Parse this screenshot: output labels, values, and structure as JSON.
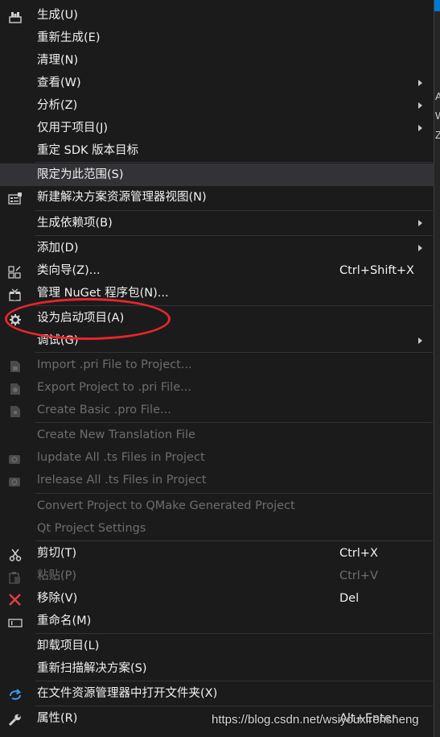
{
  "menu": {
    "items": [
      {
        "label": "生成(U)",
        "icon": "build-icon"
      },
      {
        "label": "重新生成(E)"
      },
      {
        "label": "清理(N)"
      },
      {
        "label": "查看(W)",
        "submenu": true
      },
      {
        "label": "分析(Z)",
        "submenu": true
      },
      {
        "label": "仅用于项目(J)",
        "submenu": true
      },
      {
        "label": "重定 SDK 版本目标"
      },
      {
        "label": "限定为此范围(S)",
        "highlighted": true
      },
      {
        "label": "新建解决方案资源管理器视图(N)",
        "icon": "new-solution-view-icon"
      },
      {
        "label": "生成依赖项(B)",
        "submenu": true
      },
      {
        "label": "添加(D)",
        "submenu": true
      },
      {
        "label": "类向导(Z)...",
        "shortcut": "Ctrl+Shift+X",
        "icon": "class-wizard-icon"
      },
      {
        "label": "管理 NuGet 程序包(N)...",
        "icon": "nuget-package-icon"
      },
      {
        "label": "设为启动项目(A)",
        "icon": "startup-project-gear-icon"
      },
      {
        "label": "调试(G)",
        "submenu": true
      },
      {
        "label": "Import .pri File to Project...",
        "disabled": true,
        "icon": "qt-import-icon"
      },
      {
        "label": "Export Project to .pri File...",
        "disabled": true,
        "icon": "qt-export-icon"
      },
      {
        "label": "Create Basic .pro File...",
        "disabled": true,
        "icon": "qt-pro-file-icon"
      },
      {
        "label": "Create New Translation File",
        "disabled": true
      },
      {
        "label": "lupdate All .ts Files in Project",
        "disabled": true,
        "icon": "qt-lupdate-icon"
      },
      {
        "label": "lrelease All .ts Files in Project",
        "disabled": true,
        "icon": "qt-lrelease-icon"
      },
      {
        "label": "Convert Project to QMake Generated Project",
        "disabled": true
      },
      {
        "label": "Qt Project Settings",
        "disabled": true
      },
      {
        "label": "剪切(T)",
        "shortcut": "Ctrl+X",
        "icon": "scissors-icon"
      },
      {
        "label": "粘贴(P)",
        "shortcut": "Ctrl+V",
        "disabled": true,
        "icon": "paste-icon"
      },
      {
        "label": "移除(V)",
        "shortcut": "Del",
        "icon": "remove-x-icon"
      },
      {
        "label": "重命名(M)",
        "icon": "rename-icon"
      },
      {
        "label": "卸载项目(L)"
      },
      {
        "label": "重新扫描解决方案(S)"
      },
      {
        "label": "在文件资源管理器中打开文件夹(X)",
        "icon": "open-folder-arrow-icon"
      },
      {
        "label": "属性(R)",
        "shortcut": "Alt+Enter",
        "icon": "wrench-icon"
      }
    ]
  },
  "watermark": "https://blog.csdn.net/wsiyouxirensheng",
  "background_strip": {
    "chars": [
      "A",
      "W",
      "Z"
    ]
  },
  "colors": {
    "menu_bg": "#1b1b1c",
    "text": "#f1f1f1",
    "disabled_text": "#6d6d6d",
    "highlight_bg": "#333337",
    "annotation_red": "#e8262b",
    "accent_blue": "#007acc"
  }
}
